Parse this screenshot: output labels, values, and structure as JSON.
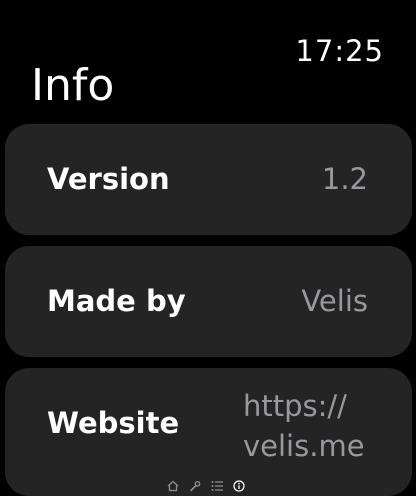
{
  "status": {
    "time": "17:25"
  },
  "page": {
    "title": "Info"
  },
  "rows": [
    {
      "label": "Version",
      "value": "1.2"
    },
    {
      "label": "Made by",
      "value": "Velis"
    },
    {
      "label": "Website",
      "value_line1": "https://",
      "value_line2": "velis.me"
    }
  ],
  "page_indicator": {
    "icons": [
      "home-icon",
      "wrench-icon",
      "list-icon",
      "info-icon"
    ],
    "active": "info-icon"
  },
  "colors": {
    "background": "#000000",
    "row_background": "#242424",
    "label": "#ffffff",
    "value": "#98989d"
  }
}
